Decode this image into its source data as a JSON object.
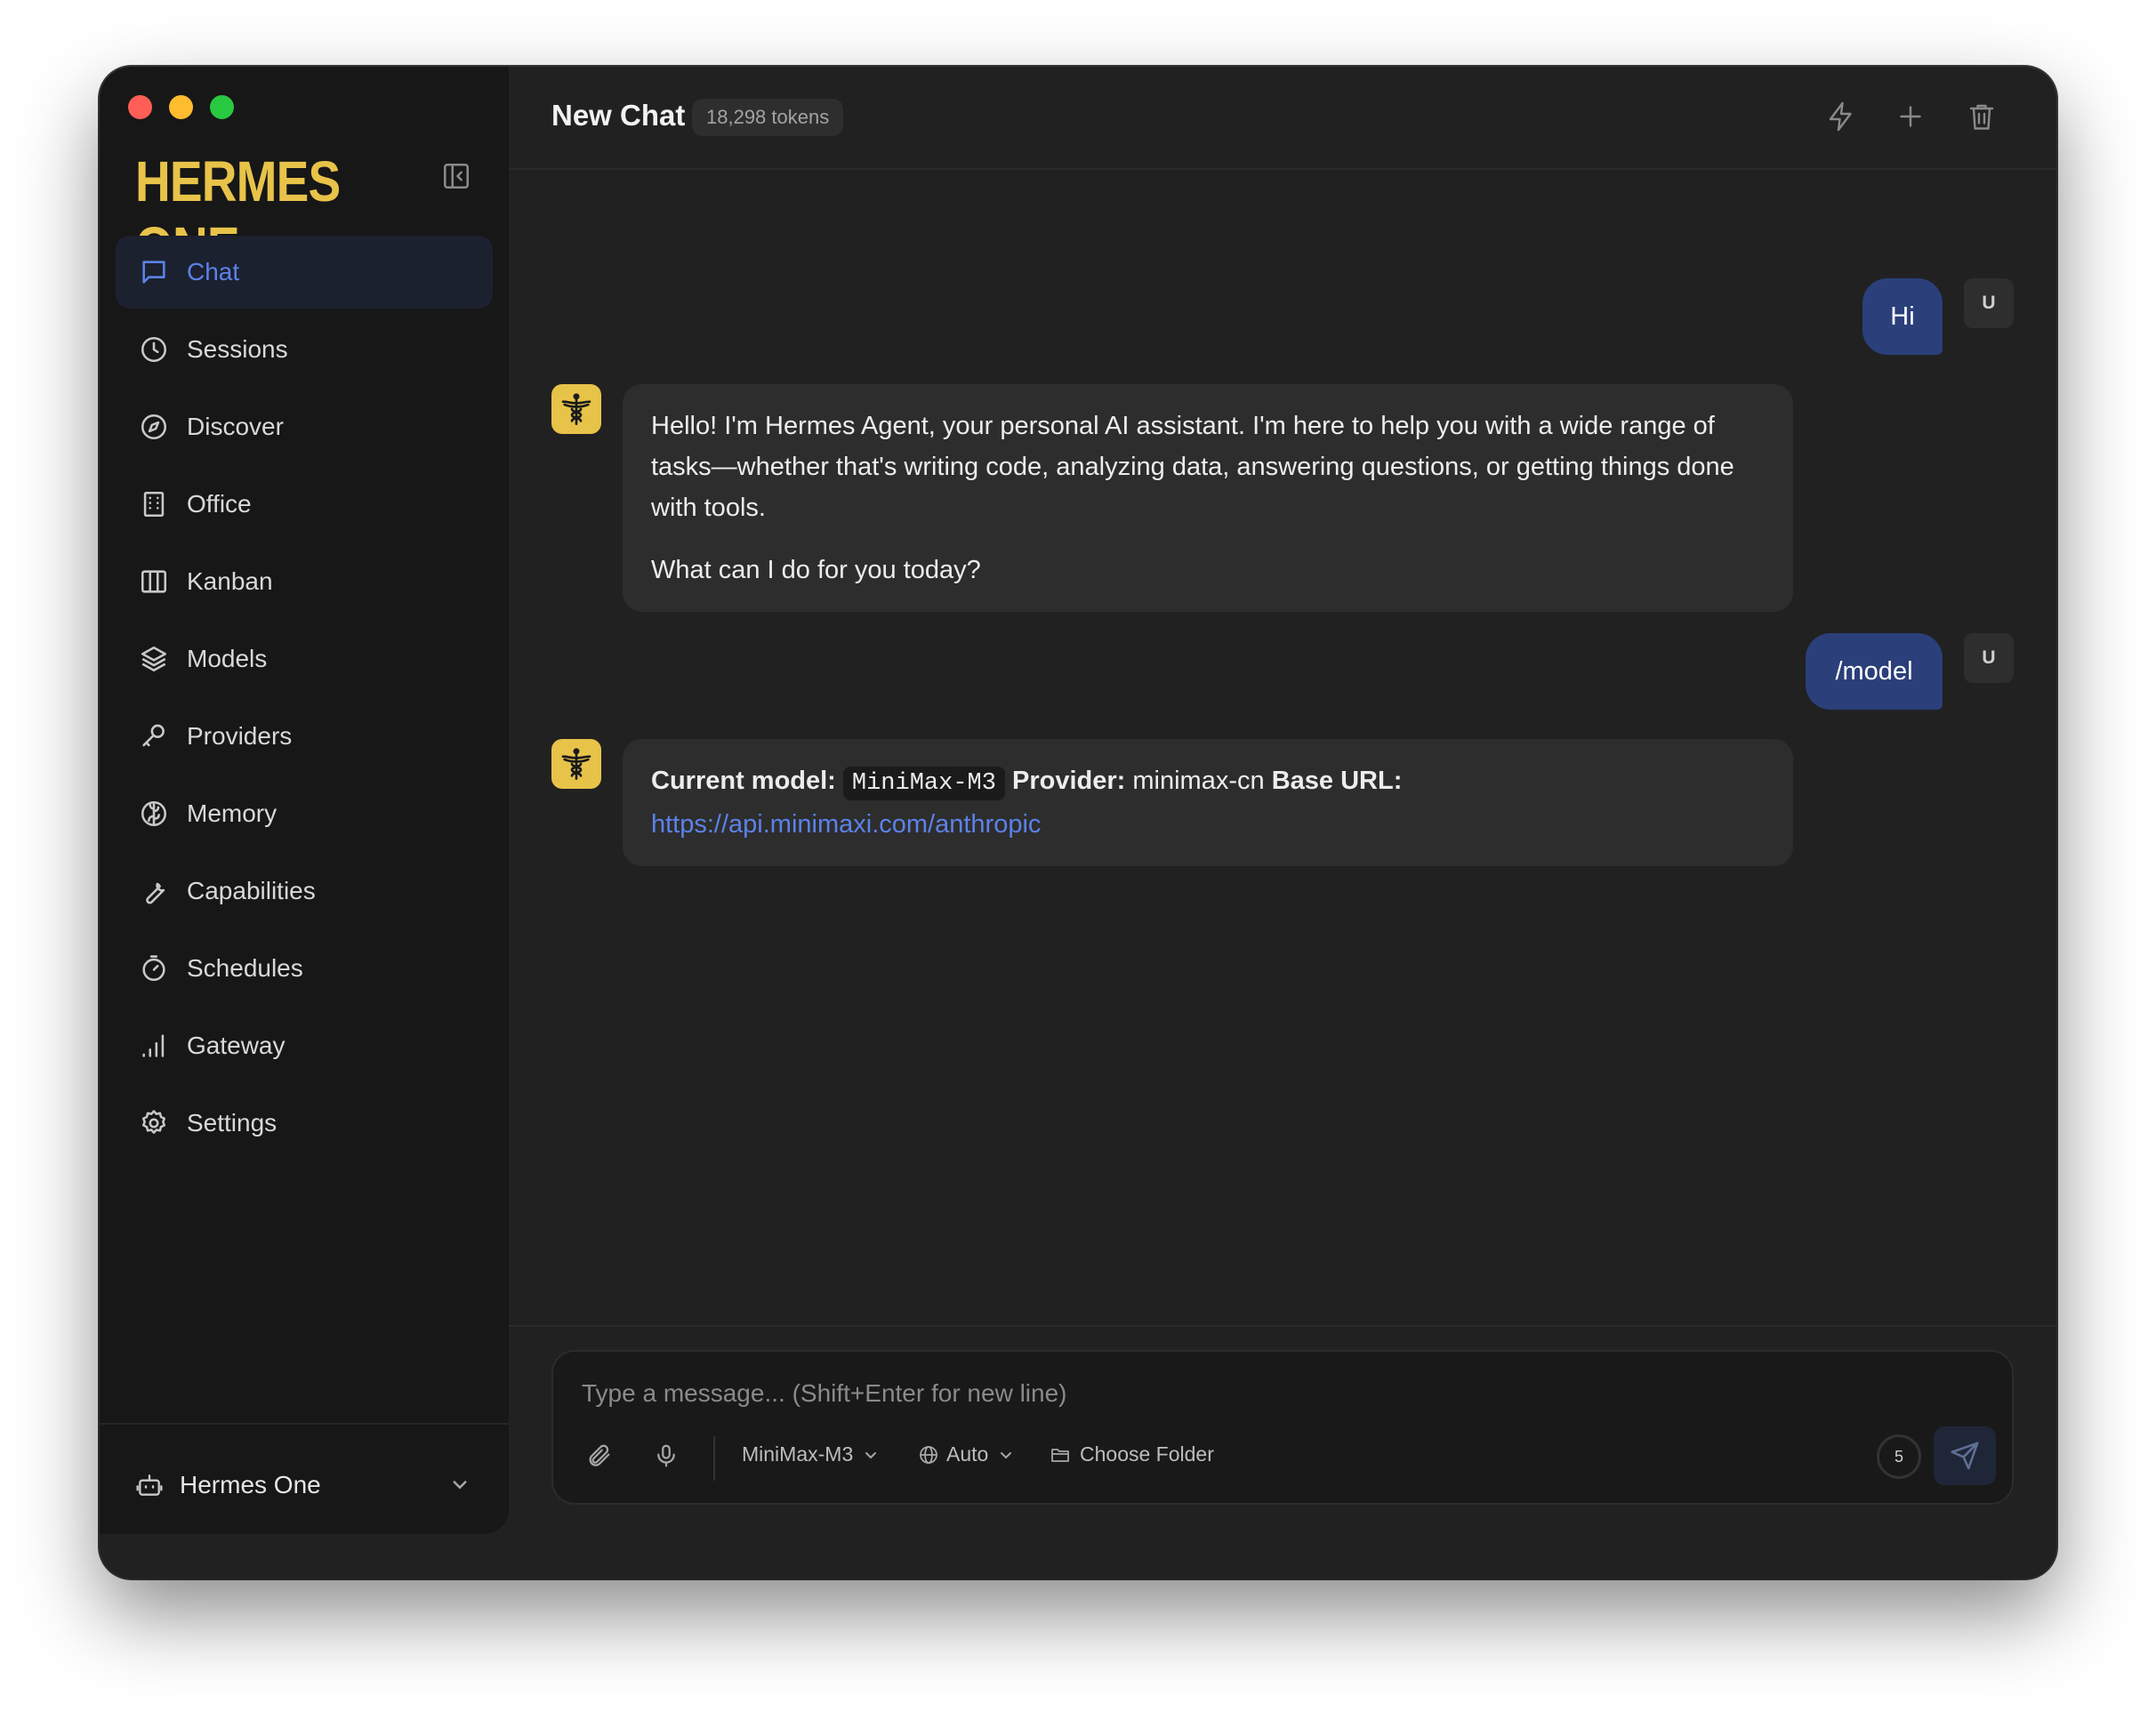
{
  "app": {
    "logo": "HERMES ONE"
  },
  "sidebar": {
    "items": [
      {
        "label": "Chat",
        "icon": "chat-bubble-icon",
        "active": true
      },
      {
        "label": "Sessions",
        "icon": "clock-icon"
      },
      {
        "label": "Discover",
        "icon": "compass-icon"
      },
      {
        "label": "Office",
        "icon": "building-icon"
      },
      {
        "label": "Kanban",
        "icon": "columns-icon"
      },
      {
        "label": "Models",
        "icon": "layers-icon"
      },
      {
        "label": "Providers",
        "icon": "key-icon"
      },
      {
        "label": "Memory",
        "icon": "brain-icon"
      },
      {
        "label": "Capabilities",
        "icon": "wrench-icon"
      },
      {
        "label": "Schedules",
        "icon": "timer-icon"
      },
      {
        "label": "Gateway",
        "icon": "signal-icon"
      },
      {
        "label": "Settings",
        "icon": "gear-icon"
      }
    ],
    "profile": {
      "label": "Hermes One",
      "icon": "bot-icon"
    }
  },
  "header": {
    "title": "New Chat",
    "tokens": "18,298 tokens"
  },
  "messages": [
    {
      "role": "user",
      "avatar": "U",
      "text": "Hi"
    },
    {
      "role": "assistant",
      "paragraphs": [
        "Hello! I'm Hermes Agent, your personal AI assistant. I'm here to help you with a wide range of tasks—whether that's writing code, analyzing data, answering questions, or getting things done with tools.",
        "What can I do for you today?"
      ]
    },
    {
      "role": "user",
      "avatar": "U",
      "text": "/model"
    },
    {
      "role": "assistant",
      "model_label": "Current model:",
      "model_value": "MiniMax-M3",
      "provider_label": "Provider:",
      "provider_value": "minimax-cn",
      "base_url_label": "Base URL:",
      "base_url": "https://api.minimaxi.com/anthropic"
    }
  ],
  "composer": {
    "placeholder": "Type a message... (Shift+Enter for new line)",
    "model": "MiniMax-M3",
    "mode": "Auto",
    "folder": "Choose Folder",
    "counter": "5"
  },
  "colors": {
    "accent": "#5b82e8",
    "brand": "#e8c349",
    "user_bubble": "#2b3f7a"
  }
}
